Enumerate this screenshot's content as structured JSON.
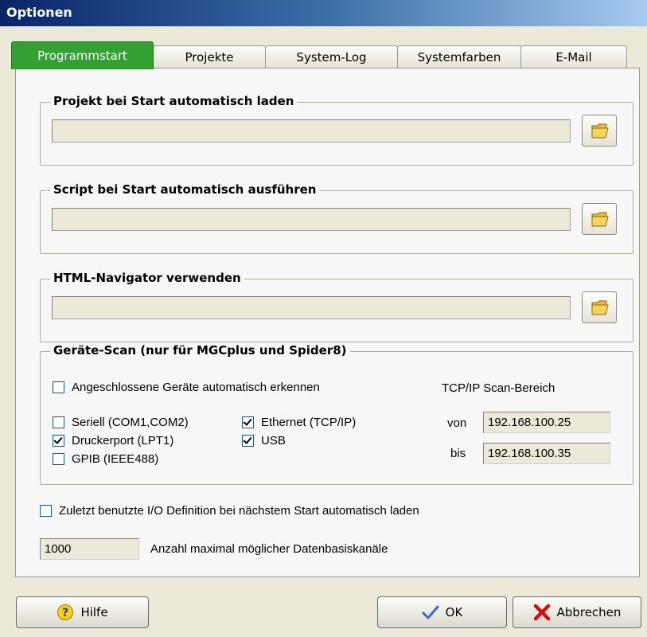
{
  "window": {
    "title": "Optionen"
  },
  "tabs": [
    {
      "label": "Programmstart",
      "active": true
    },
    {
      "label": "Projekte",
      "active": false
    },
    {
      "label": "System-Log",
      "active": false
    },
    {
      "label": "Systemfarben",
      "active": false
    },
    {
      "label": "E-Mail",
      "active": false
    }
  ],
  "groups": {
    "project": {
      "title": "Projekt bei Start automatisch laden",
      "path_value": ""
    },
    "script": {
      "title": "Script bei Start automatisch ausführen",
      "path_value": ""
    },
    "navigator": {
      "title": "HTML-Navigator verwenden",
      "path_value": ""
    },
    "scan": {
      "title": "Geräte-Scan (nur für MGCplus und Spider8)",
      "auto_detect": {
        "label": "Angeschlossene Geräte automatisch erkennen",
        "checked": false
      },
      "serial": {
        "label": "Seriell (COM1,COM2)",
        "checked": false
      },
      "printer": {
        "label": "Druckerport (LPT1)",
        "checked": true
      },
      "gpib": {
        "label": "GPIB (IEEE488)",
        "checked": false
      },
      "ethernet": {
        "label": "Ethernet (TCP/IP)",
        "checked": true
      },
      "usb": {
        "label": "USB",
        "checked": true
      },
      "tcp_range_label": "TCP/IP Scan-Bereich",
      "from_label": "von",
      "from_value": "192.168.100.25",
      "to_label": "bis",
      "to_value": "192.168.100.35"
    }
  },
  "io_definition": {
    "label": "Zuletzt benutzte I/O Definition bei nächstem Start automatisch laden",
    "checked": false
  },
  "channels": {
    "value": "1000",
    "label": "Anzahl maximal möglicher Datenbasiskanäle"
  },
  "buttons": {
    "help": "Hilfe",
    "ok": "OK",
    "cancel": "Abbrechen"
  },
  "icons": {
    "folder": "folder-open-icon",
    "help": "help-icon",
    "ok": "checkmark-icon",
    "cancel": "red-x-icon"
  }
}
